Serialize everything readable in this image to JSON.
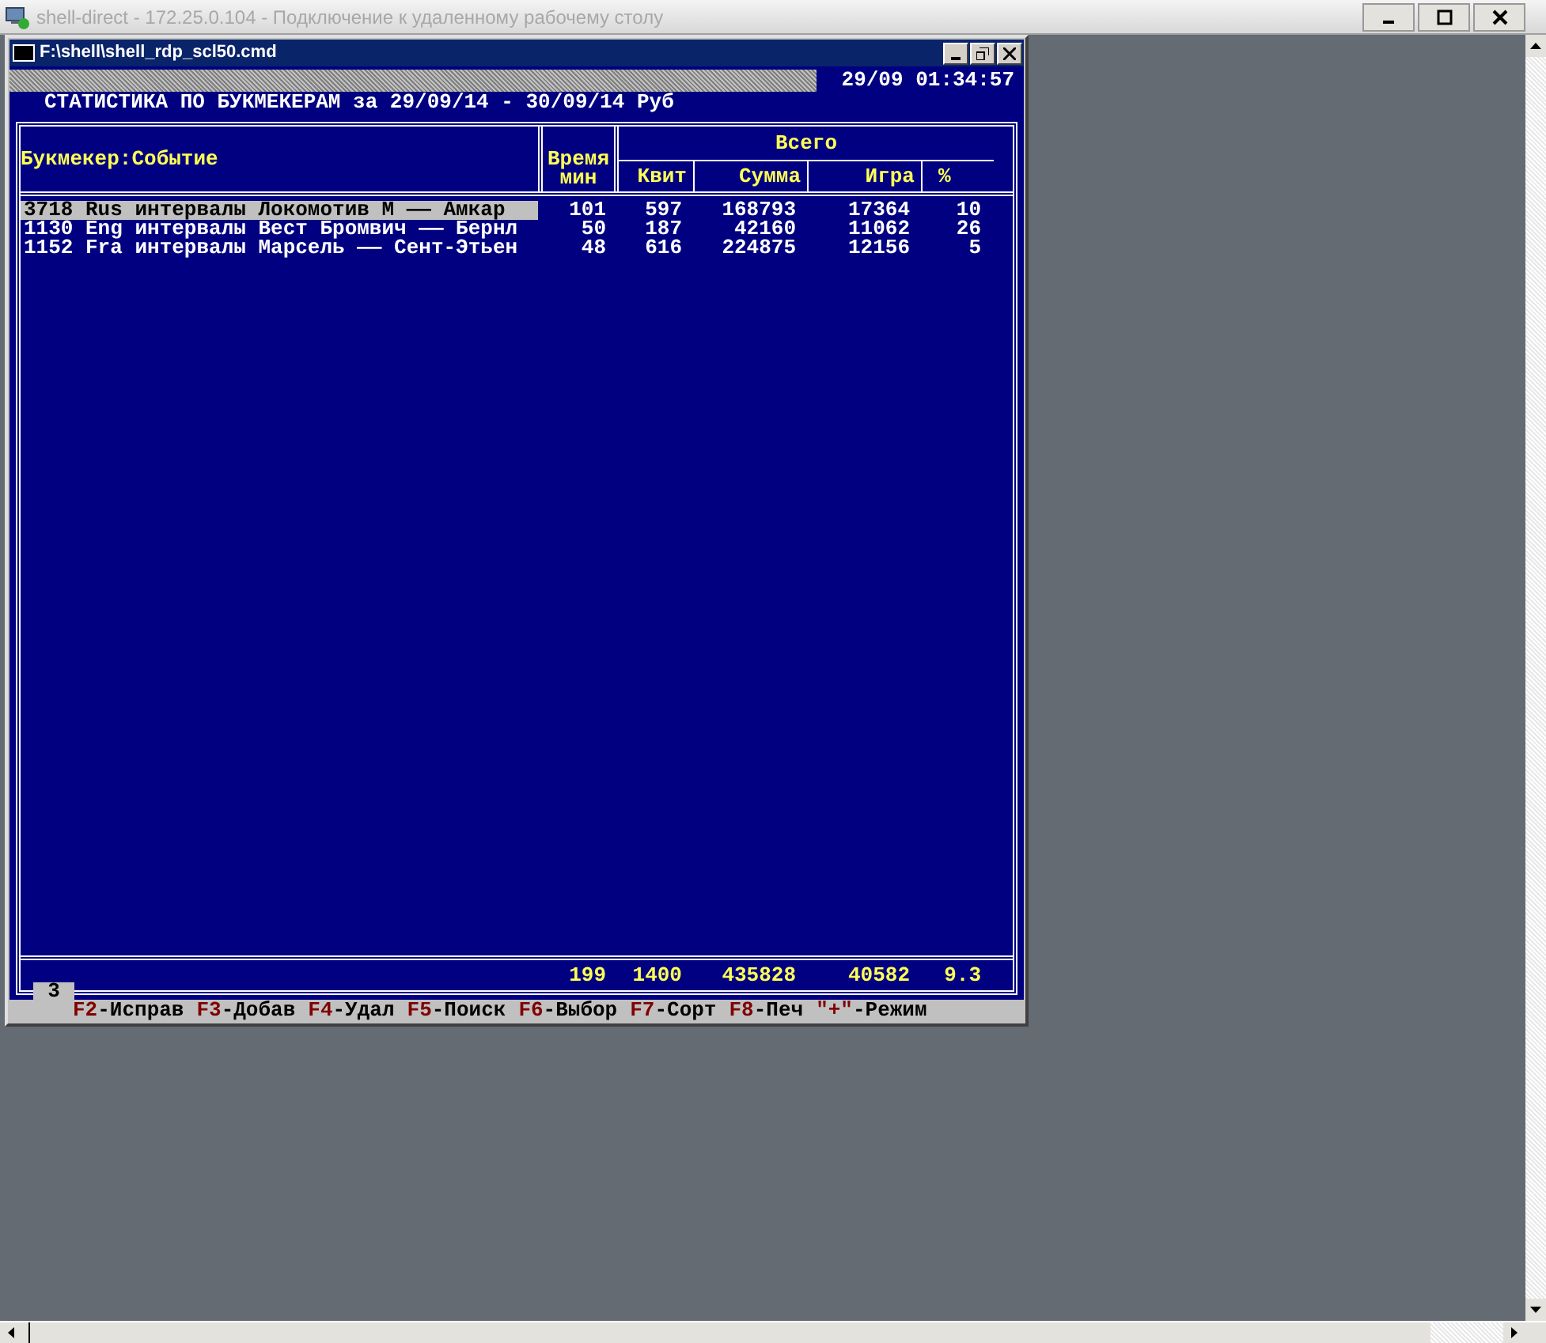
{
  "remote_window": {
    "title": "shell-direct - 172.25.0.104 - Подключение к удаленному рабочему столу"
  },
  "console_window": {
    "title": "F:\\shell\\shell_rdp_scl50.cmd"
  },
  "clock": "29/09 01:34:57",
  "report_title": "СТАТИСТИКА ПО БУКМЕКЕРАМ за 29/09/14 - 30/09/14 Руб",
  "table": {
    "headers": {
      "event": "Букмекер:Событие",
      "time": "Время",
      "time_unit": "мин",
      "group": "Всего",
      "kvit": "Квит",
      "sum": "Сумма",
      "game": "Игра",
      "pct": "%"
    },
    "rows": [
      {
        "event": "3718 Rus интервалы Локомотив М —— Амкар",
        "time": "101",
        "kvit": "597",
        "sum": "168793",
        "game": "17364",
        "pct": "10",
        "selected": true
      },
      {
        "event": "1130 Eng интервалы Вест Бромвич —— Бернл",
        "time": "50",
        "kvit": "187",
        "sum": "42160",
        "game": "11062",
        "pct": "26",
        "selected": false
      },
      {
        "event": "1152 Fra интервалы Марсель —— Сент-Этьен",
        "time": "48",
        "kvit": "616",
        "sum": "224875",
        "game": "12156",
        "pct": "5",
        "selected": false
      }
    ],
    "totals": {
      "time": "199",
      "kvit": "1400",
      "sum": "435828",
      "game": "40582",
      "pct": "9.3"
    }
  },
  "page_tab": "3",
  "hotkeys": [
    {
      "key": "F2",
      "action": "-Исправ"
    },
    {
      "key": "F3",
      "action": "-Добав"
    },
    {
      "key": "F4",
      "action": "-Удал"
    },
    {
      "key": "F5",
      "action": "-Поиск"
    },
    {
      "key": "F6",
      "action": "-Выбор"
    },
    {
      "key": "F7",
      "action": "-Сорт"
    },
    {
      "key": "F8",
      "action": "-Печ"
    },
    {
      "key": "\"+\"",
      "action": "-Режим"
    }
  ]
}
